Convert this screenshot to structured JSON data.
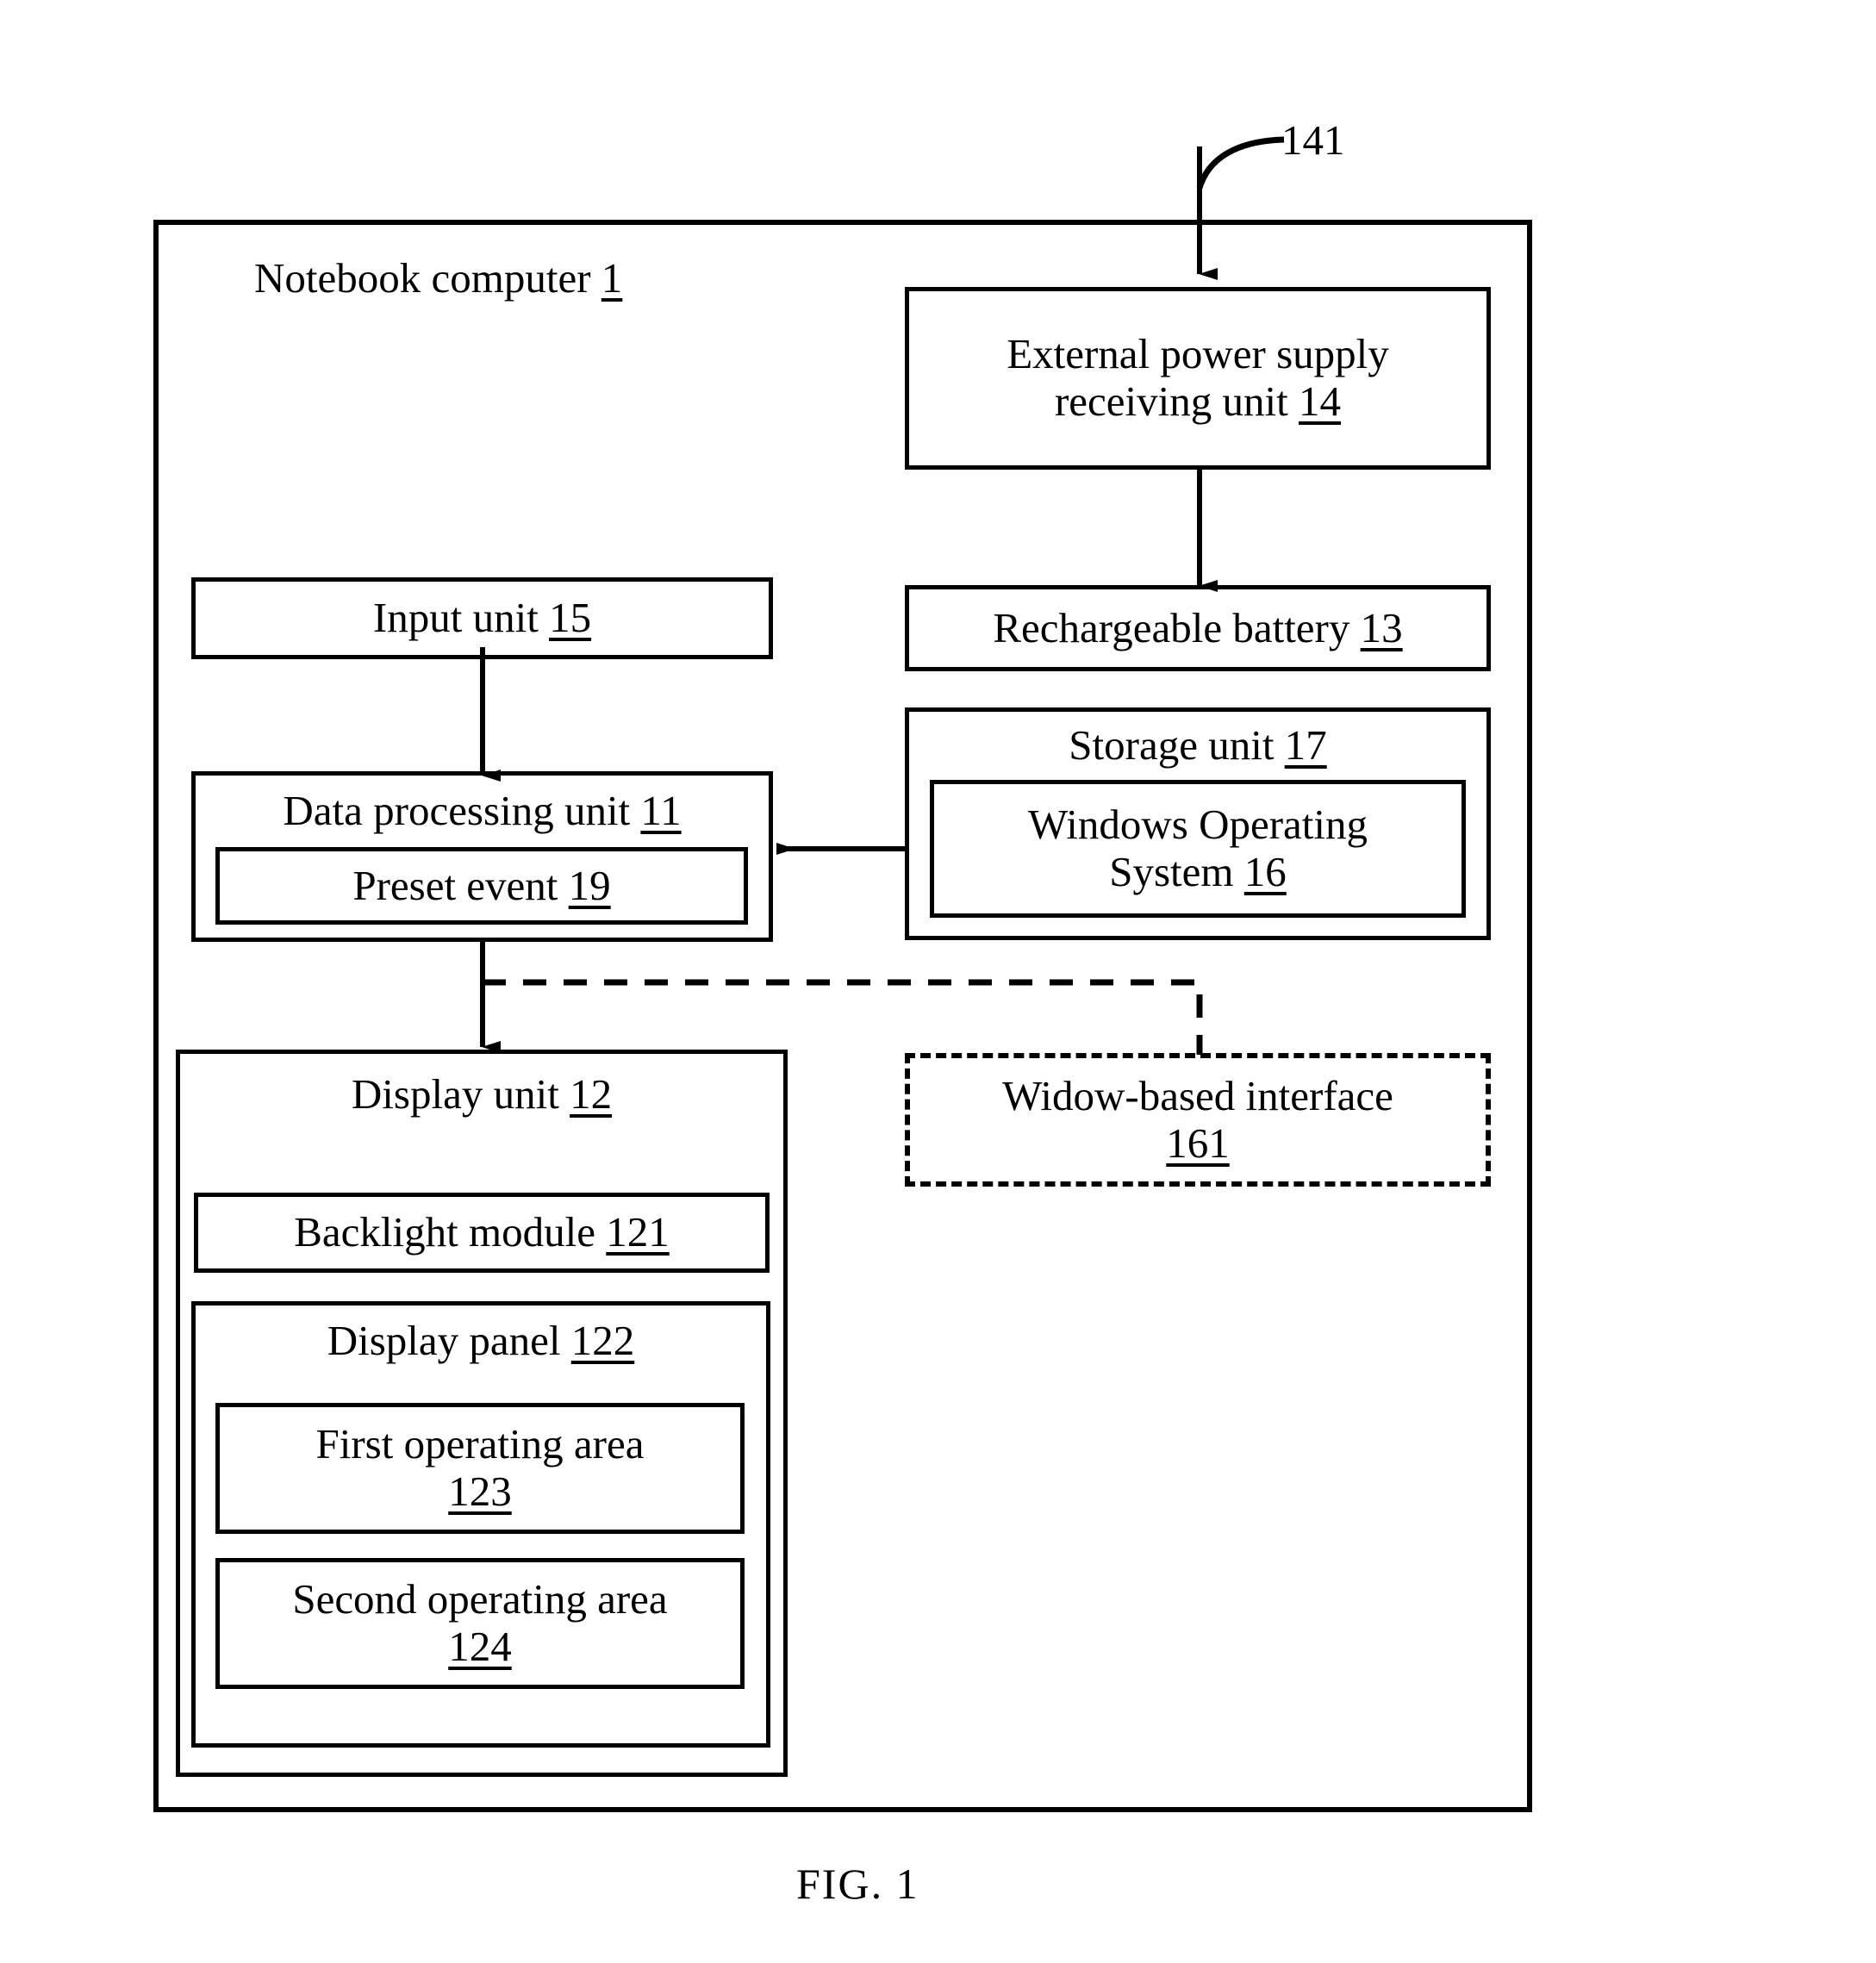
{
  "figure": {
    "caption": "FIG. 1",
    "outer_container": {
      "title": "Notebook computer",
      "ref": "1"
    },
    "callout": {
      "label": "141"
    }
  },
  "blocks": {
    "external_power": {
      "line1": "External power supply",
      "line2": "receiving unit",
      "ref": "14"
    },
    "rechargeable_battery": {
      "text": "Rechargeable battery",
      "ref": "13"
    },
    "input_unit": {
      "text": "Input unit",
      "ref": "15"
    },
    "data_processing_unit": {
      "text": "Data processing unit",
      "ref": "11"
    },
    "preset_event": {
      "text": "Preset event",
      "ref": "19"
    },
    "storage_unit": {
      "text": "Storage unit",
      "ref": "17"
    },
    "windows_os": {
      "line1": "Windows Operating",
      "line2": "System",
      "ref": "16"
    },
    "window_interface": {
      "line1": "Widow-based interface",
      "ref": "161"
    },
    "display_unit": {
      "text": "Display unit",
      "ref": "12"
    },
    "backlight_module": {
      "text": "Backlight module",
      "ref": "121"
    },
    "display_panel": {
      "text": "Display panel",
      "ref": "122"
    },
    "first_operating_area": {
      "line1": "First operating area",
      "ref": "123"
    },
    "second_operating_area": {
      "line1": "Second operating area",
      "ref": "124"
    }
  },
  "colors": {
    "stroke": "#000000",
    "background": "#ffffff"
  }
}
